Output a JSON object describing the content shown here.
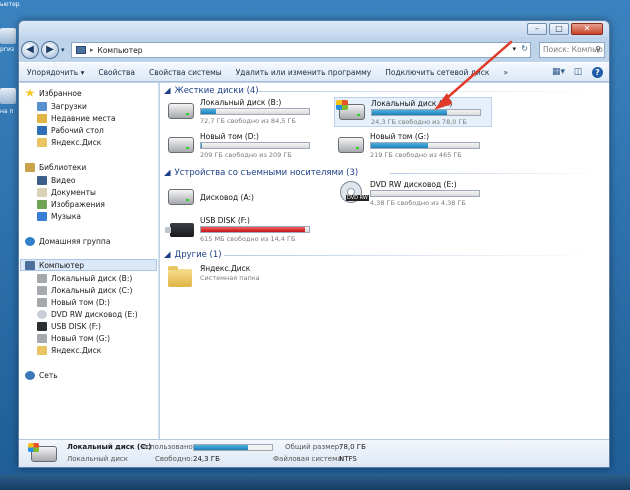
{
  "desktop": {
    "labels": [
      "ьютер",
      "ргиз",
      "на п"
    ]
  },
  "window": {
    "buttons": {
      "minimize": "–",
      "maximize": "□",
      "close": "✕"
    }
  },
  "address": {
    "path": "Компьютер",
    "separator": "▸",
    "search_placeholder": "Поиск: Компью..."
  },
  "toolbar": {
    "items": [
      "Упорядочить ▾",
      "Свойства",
      "Свойства системы",
      "Удалить или изменить программу",
      "Подключить сетевой диск",
      "»"
    ]
  },
  "sidebar": {
    "favorites": "Избранное",
    "fav_items": [
      "Загрузки",
      "Недавние места",
      "Рабочий стол",
      "Яндекс.Диск"
    ],
    "libraries": "Библиотеки",
    "lib_items": [
      "Видео",
      "Документы",
      "Изображения",
      "Музыка"
    ],
    "homegroup": "Домашняя группа",
    "computer": "Компьютер",
    "comp_items": [
      "Локальный диск (B:)",
      "Локальный диск (C:)",
      "Новый том (D:)",
      "DVD RW дисковод (E:)",
      "USB DISK (F:)",
      "Новый том (G:)",
      "Яндекс.Диск"
    ],
    "network": "Сеть"
  },
  "groups": {
    "hdd": "Жесткие диски (4)",
    "removable": "Устройства со съемными носителями (3)",
    "other": "Другие (1)"
  },
  "drives": {
    "b": {
      "name": "Локальный диск (B:)",
      "free": "72,7 ГБ свободно из 84,5 ГБ",
      "used_fraction": 0.14
    },
    "c": {
      "name": "Локальный диск (C:)",
      "free": "24,3 ГБ свободно из 78,0 ГБ",
      "used_fraction": 0.69
    },
    "d": {
      "name": "Новый том (D:)",
      "free": "209 ГБ свободно из 209 ГБ",
      "used_fraction": 0.01
    },
    "g": {
      "name": "Новый том (G:)",
      "free": "219 ГБ свободно из 465 ГБ",
      "used_fraction": 0.53
    },
    "a": {
      "name": "Дисковод (A:)"
    },
    "e": {
      "name": "DVD RW дисковод (E:)",
      "free": "4,38 ГБ свободно из 4,38 ГБ",
      "used_fraction": 0.0,
      "tag": "DVD RW"
    },
    "f": {
      "name": "USB DISK (F:)",
      "free": "615 МБ свободно из 14,4 ГБ",
      "used_fraction": 0.96
    },
    "yandex": {
      "name": "Яндекс.Диск",
      "sub": "Системная папка"
    }
  },
  "details": {
    "name": "Локальный диск (C:)",
    "type": "Локальный диск",
    "used_label": "Использовано:",
    "used_fraction": 0.69,
    "free_label": "Свободно:",
    "free_value": "24,3 ГБ",
    "total_label": "Общий размер:",
    "total_value": "78,0 ГБ",
    "fs_label": "Файловая система:",
    "fs_value": "NTFS"
  },
  "colors": {
    "bar": "#1d7fb8",
    "bar_full": "#c41414",
    "arrow": "#e03a2a",
    "group_head": "#1e3f87"
  }
}
